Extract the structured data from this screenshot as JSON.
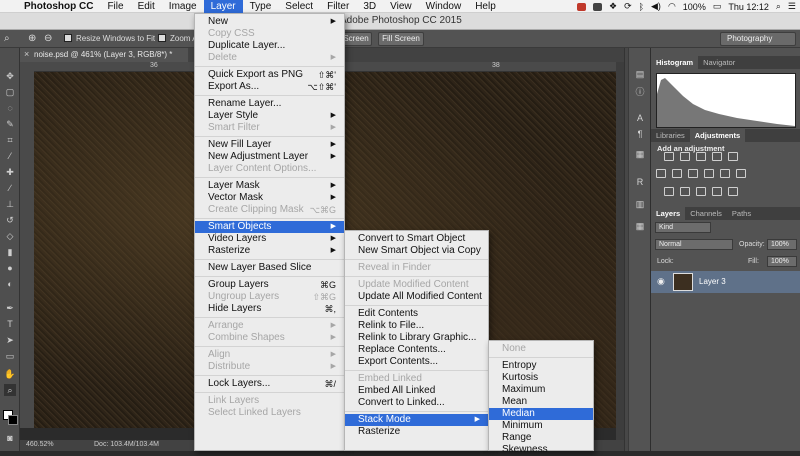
{
  "menubar": {
    "app": "Photoshop CC",
    "items": [
      "File",
      "Edit",
      "Image",
      "Layer",
      "Type",
      "Select",
      "Filter",
      "3D",
      "View",
      "Window",
      "Help"
    ],
    "active": "Layer",
    "battery": "100%",
    "clock": "Thu 12:12"
  },
  "window_title": "Adobe Photoshop CC 2015",
  "options": {
    "resize_windows": "Resize Windows to Fit",
    "zoom_all": "Zoom A",
    "screen_btn": "Screen",
    "fill_screen": "Fill Screen",
    "workspace": "Photography"
  },
  "doc_tab": "noise.psd @ 461% (Layer 3, RGB/8*) *",
  "ruler": {
    "t1": "36",
    "t2": "38"
  },
  "status": {
    "zoom": "460.52%",
    "doc": "Doc: 103.4M/103.4M"
  },
  "panels": {
    "histogram_tabs": [
      "Histogram",
      "Navigator"
    ],
    "adj_tabs": [
      "Libraries",
      "Adjustments"
    ],
    "add_adjustment": "Add an adjustment",
    "layer_tabs": [
      "Layers",
      "Channels",
      "Paths"
    ],
    "kind": "Kind",
    "blend": "Normal",
    "opacity_label": "Opacity:",
    "opacity": "100%",
    "lock_label": "Lock:",
    "fill_label": "Fill:",
    "fill": "100%",
    "layer_name": "Layer 3"
  },
  "layer_menu": [
    {
      "label": "New",
      "arrow": true
    },
    {
      "label": "Copy CSS",
      "disabled": true
    },
    {
      "label": "Duplicate Layer..."
    },
    {
      "label": "Delete",
      "arrow": true,
      "disabled": true
    },
    {
      "sep": true
    },
    {
      "label": "Quick Export as PNG",
      "shortcut": "⇧⌘'"
    },
    {
      "label": "Export As...",
      "shortcut": "⌥⇧⌘'"
    },
    {
      "sep": true
    },
    {
      "label": "Rename Layer..."
    },
    {
      "label": "Layer Style",
      "arrow": true
    },
    {
      "label": "Smart Filter",
      "arrow": true,
      "disabled": true
    },
    {
      "sep": true
    },
    {
      "label": "New Fill Layer",
      "arrow": true
    },
    {
      "label": "New Adjustment Layer",
      "arrow": true
    },
    {
      "label": "Layer Content Options...",
      "disabled": true
    },
    {
      "sep": true
    },
    {
      "label": "Layer Mask",
      "arrow": true
    },
    {
      "label": "Vector Mask",
      "arrow": true
    },
    {
      "label": "Create Clipping Mask",
      "shortcut": "⌥⌘G",
      "disabled": true
    },
    {
      "sep": true
    },
    {
      "label": "Smart Objects",
      "arrow": true,
      "selected": true
    },
    {
      "label": "Video Layers",
      "arrow": true
    },
    {
      "label": "Rasterize",
      "arrow": true
    },
    {
      "sep": true
    },
    {
      "label": "New Layer Based Slice"
    },
    {
      "sep": true
    },
    {
      "label": "Group Layers",
      "shortcut": "⌘G"
    },
    {
      "label": "Ungroup Layers",
      "shortcut": "⇧⌘G",
      "disabled": true
    },
    {
      "label": "Hide Layers",
      "shortcut": "⌘,"
    },
    {
      "sep": true
    },
    {
      "label": "Arrange",
      "arrow": true,
      "disabled": true
    },
    {
      "label": "Combine Shapes",
      "arrow": true,
      "disabled": true
    },
    {
      "sep": true
    },
    {
      "label": "Align",
      "arrow": true,
      "disabled": true
    },
    {
      "label": "Distribute",
      "arrow": true,
      "disabled": true
    },
    {
      "sep": true
    },
    {
      "label": "Lock Layers...",
      "shortcut": "⌘/"
    },
    {
      "sep": true
    },
    {
      "label": "Link Layers",
      "disabled": true
    },
    {
      "label": "Select Linked Layers",
      "disabled": true
    }
  ],
  "smart_menu": [
    {
      "label": "Convert to Smart Object"
    },
    {
      "label": "New Smart Object via Copy"
    },
    {
      "sep": true
    },
    {
      "label": "Reveal in Finder",
      "disabled": true
    },
    {
      "sep": true
    },
    {
      "label": "Update Modified Content",
      "disabled": true
    },
    {
      "label": "Update All Modified Content"
    },
    {
      "sep": true
    },
    {
      "label": "Edit Contents"
    },
    {
      "label": "Relink to File..."
    },
    {
      "label": "Relink to Library Graphic..."
    },
    {
      "label": "Replace Contents..."
    },
    {
      "label": "Export Contents..."
    },
    {
      "sep": true
    },
    {
      "label": "Embed Linked",
      "disabled": true
    },
    {
      "label": "Embed All Linked"
    },
    {
      "label": "Convert to Linked..."
    },
    {
      "sep": true
    },
    {
      "label": "Stack Mode",
      "arrow": true,
      "selected": true
    },
    {
      "label": "Rasterize"
    }
  ],
  "stack_menu": [
    {
      "label": "None",
      "disabled": true
    },
    {
      "sep": true
    },
    {
      "label": "Entropy"
    },
    {
      "label": "Kurtosis"
    },
    {
      "label": "Maximum"
    },
    {
      "label": "Mean"
    },
    {
      "label": "Median",
      "selected": true
    },
    {
      "label": "Minimum"
    },
    {
      "label": "Range"
    },
    {
      "label": "Skewness"
    }
  ]
}
